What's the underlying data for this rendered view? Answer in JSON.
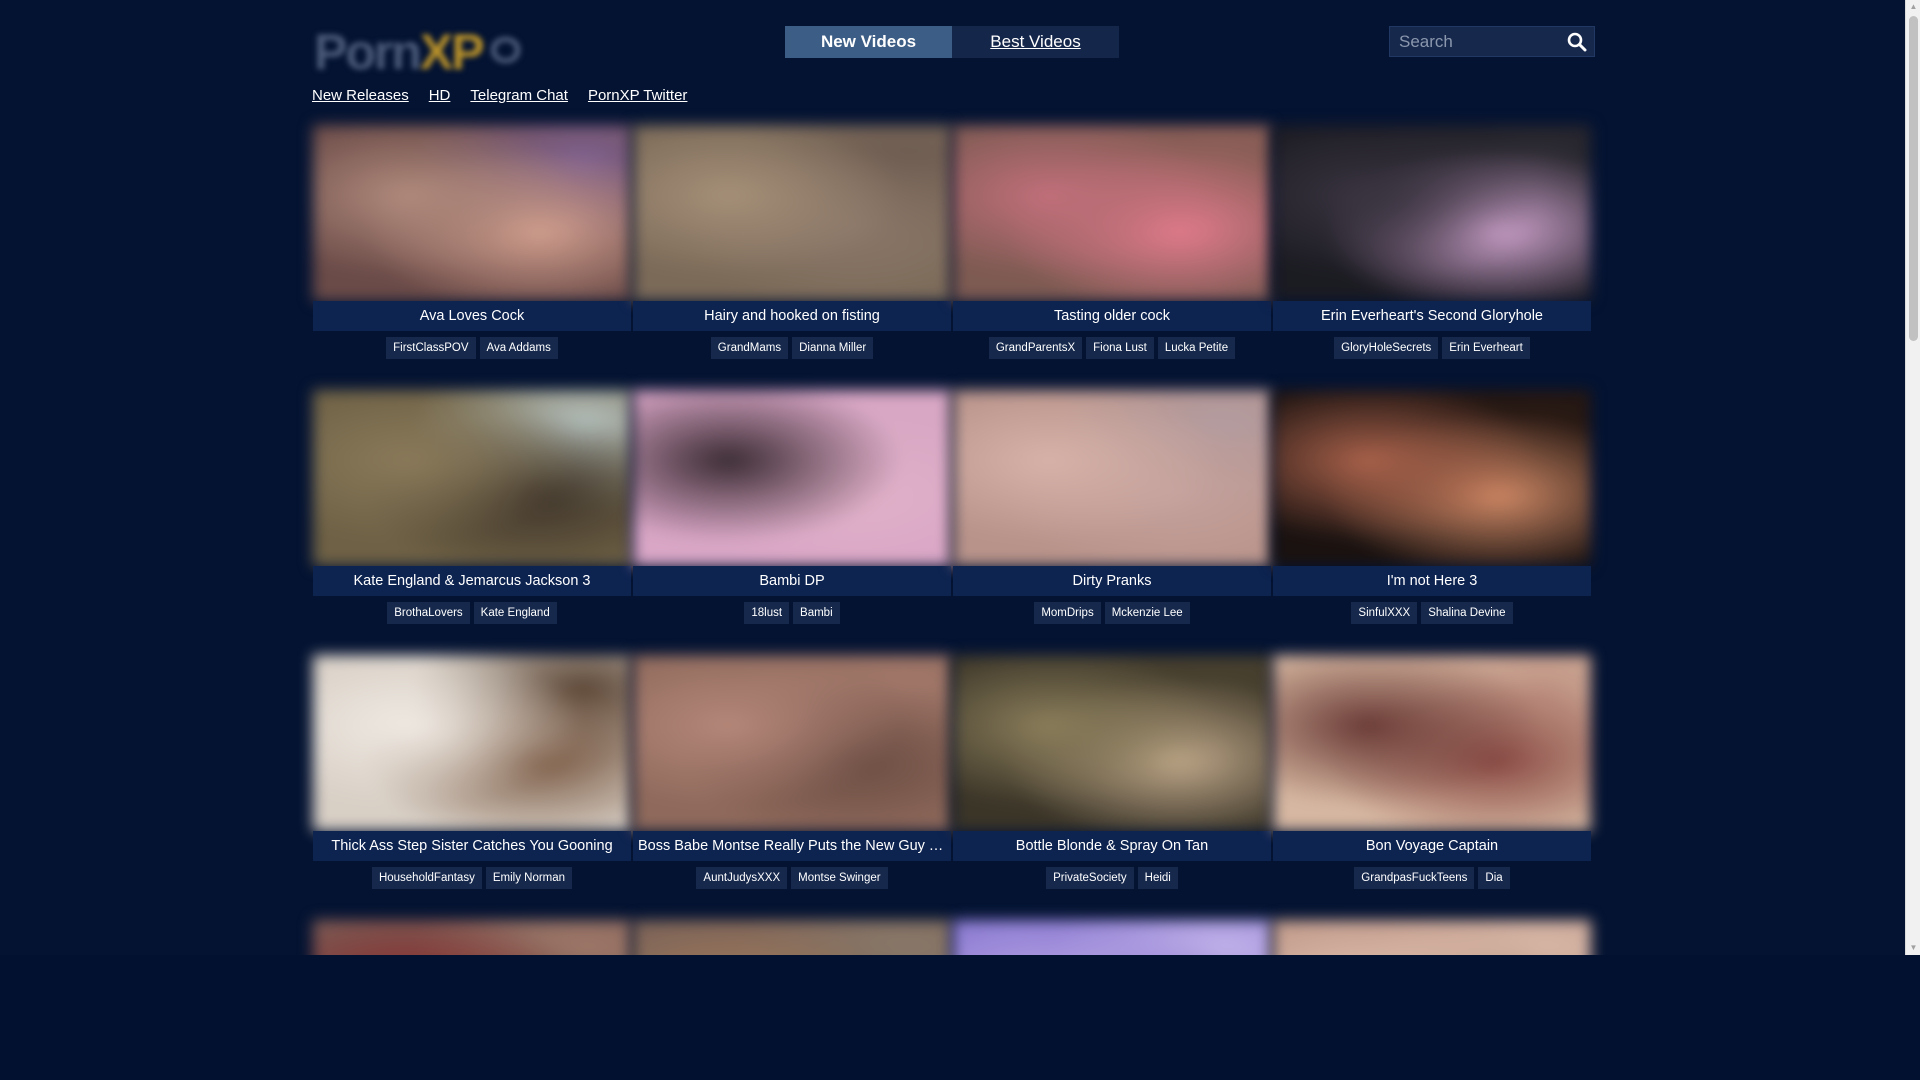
{
  "brand": {
    "name": "PornXP",
    "accent": "#3c5d85",
    "background": "#041332"
  },
  "header": {
    "tabs": [
      {
        "label": "New Videos",
        "active": true
      },
      {
        "label": "Best Videos",
        "active": false
      }
    ],
    "search": {
      "placeholder": "Search",
      "value": "",
      "icon": "search-icon"
    }
  },
  "subnav": [
    {
      "label": "New Releases"
    },
    {
      "label": "HD"
    },
    {
      "label": "Telegram Chat"
    },
    {
      "label": "PornXP Twitter"
    }
  ],
  "videos": [
    {
      "title": "Ava Loves Cock",
      "tags": [
        "FirstClassPOV",
        "Ava Addams"
      ],
      "thumb_colors": [
        "#6b4b48",
        "#b08a7c",
        "#d3a08f",
        "#7d5f8e"
      ]
    },
    {
      "title": "Hairy and hooked on fisting",
      "tags": [
        "GrandMams",
        "Dianna Miller"
      ],
      "thumb_colors": [
        "#7b6a58",
        "#a58f78",
        "#8a7668",
        "#6e5c52"
      ]
    },
    {
      "title": "Tasting older cock",
      "tags": [
        "GrandParentsX",
        "Fiona Lust",
        "Lucka Petite"
      ],
      "thumb_colors": [
        "#7d5a52",
        "#c16f7a",
        "#e37b8d",
        "#8e5f58"
      ]
    },
    {
      "title": "Erin Everheart's Second Gloryhole",
      "tags": [
        "GloryHoleSecrets",
        "Erin Everheart"
      ],
      "thumb_colors": [
        "#1b1b22",
        "#3a3440",
        "#d1a4cf",
        "#2d2b33"
      ]
    },
    {
      "title": "Kate England & Jemarcus Jackson 3",
      "tags": [
        "BrothaLovers",
        "Kate England"
      ],
      "thumb_colors": [
        "#6e6145",
        "#8a7a5a",
        "#3f352a",
        "#b6c2bf"
      ]
    },
    {
      "title": "Bambi DP",
      "tags": [
        "18lust",
        "Bambi"
      ],
      "thumb_colors": [
        "#d9a6c6",
        "#3b2c34",
        "#e0b0c8",
        "#d7a7c3"
      ]
    },
    {
      "title": "Dirty Pranks",
      "tags": [
        "MomDrips",
        "Mckenzie Lee"
      ],
      "thumb_colors": [
        "#b8938a",
        "#d6b2a9",
        "#c4a19c",
        "#b29b9f"
      ]
    },
    {
      "title": "I'm not Here 3",
      "tags": [
        "SinfulXXX",
        "Shalina Devine"
      ],
      "thumb_colors": [
        "#1a1210",
        "#a8614a",
        "#d18a66",
        "#2a1a14"
      ]
    },
    {
      "title": "Thick Ass Step Sister Catches You Gooning",
      "tags": [
        "HouseholdFantasy",
        "Emily Norman"
      ],
      "thumb_colors": [
        "#d8cfc5",
        "#efe9e2",
        "#7a5a44",
        "#5b4636"
      ]
    },
    {
      "title": "Boss Babe Montse Really Puts the New Guy T…",
      "tags": [
        "AuntJudysXXX",
        "Montse Swinger"
      ],
      "thumb_colors": [
        "#8f6a5c",
        "#b48779",
        "#6b4c42",
        "#a2786a"
      ]
    },
    {
      "title": "Bottle Blonde & Spray On Tan",
      "tags": [
        "PrivateSociety",
        "Heidi"
      ],
      "thumb_colors": [
        "#3b3528",
        "#8a7d5a",
        "#c0a88a",
        "#4a4230"
      ]
    },
    {
      "title": "Bon Voyage Captain",
      "tags": [
        "GrandpasFuckTeens",
        "Dia"
      ],
      "thumb_colors": [
        "#d6b7a1",
        "#6a3b36",
        "#8a4a44",
        "#c09484"
      ]
    },
    {
      "title": "",
      "tags": [],
      "thumb_colors": [
        "#7a5a54",
        "#8a2a2a",
        "#5a3a34",
        "#a07a6a"
      ]
    },
    {
      "title": "",
      "tags": [],
      "thumb_colors": [
        "#7a6258",
        "#a07a5a",
        "#6a5a4a",
        "#8a7a6a"
      ]
    },
    {
      "title": "",
      "tags": [],
      "thumb_colors": [
        "#8a7ad0",
        "#b8a4e6",
        "#6a5ab8",
        "#c4b4ea"
      ]
    },
    {
      "title": "",
      "tags": [],
      "thumb_colors": [
        "#c09a8a",
        "#e0c0b0",
        "#a07a6a",
        "#d8b8a8"
      ]
    }
  ]
}
